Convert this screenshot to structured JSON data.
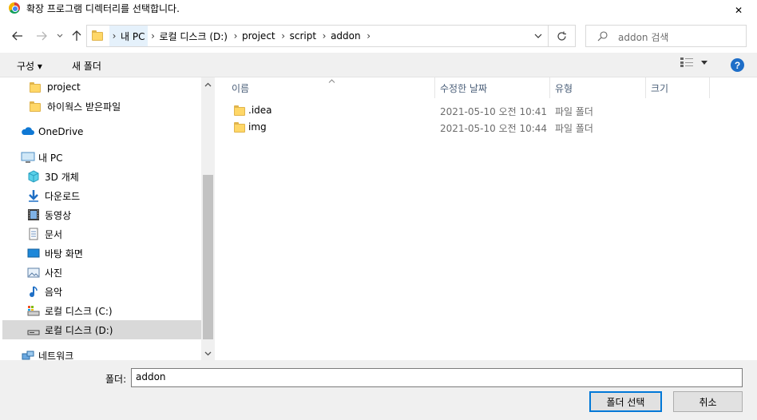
{
  "window": {
    "title": "확장 프로그램 디렉터리를 선택합니다.",
    "close_glyph": "✕"
  },
  "address": {
    "crumbs": [
      "내 PC",
      "로컬 디스크 (D:)",
      "project",
      "script",
      "addon"
    ]
  },
  "search": {
    "placeholder": "addon 검색"
  },
  "toolbar": {
    "organize": "구성 ▾",
    "new_folder": "새 폴더",
    "help": "?"
  },
  "nav": {
    "items": [
      {
        "label": "project",
        "icon": "folder-icon"
      },
      {
        "label": "하이웍스 받은파일",
        "icon": "folder-icon"
      },
      {
        "label": "OneDrive",
        "icon": "cloud-icon"
      },
      {
        "label": "내 PC",
        "icon": "computer-icon"
      },
      {
        "label": "3D 개체",
        "icon": "cube-icon"
      },
      {
        "label": "다운로드",
        "icon": "download-icon"
      },
      {
        "label": "동영상",
        "icon": "video-icon"
      },
      {
        "label": "문서",
        "icon": "document-icon"
      },
      {
        "label": "바탕 화면",
        "icon": "desktop-icon"
      },
      {
        "label": "사진",
        "icon": "pictures-icon"
      },
      {
        "label": "음악",
        "icon": "music-icon"
      },
      {
        "label": "로컬 디스크 (C:)",
        "icon": "drive-icon"
      },
      {
        "label": "로컬 디스크 (D:)",
        "icon": "drive-icon",
        "selected": true
      },
      {
        "label": "네트워크",
        "icon": "network-icon"
      }
    ]
  },
  "columns": {
    "name": "이름",
    "date": "수정한 날짜",
    "type": "유형",
    "size": "크기"
  },
  "files": [
    {
      "name": ".idea",
      "date": "2021-05-10 오전 10:41",
      "type": "파일 폴더"
    },
    {
      "name": "img",
      "date": "2021-05-10 오전 10:44",
      "type": "파일 폴더"
    }
  ],
  "footer": {
    "folder_label": "폴더:",
    "folder_value": "addon",
    "select_button": "폴더 선택",
    "cancel_button": "취소"
  },
  "colors": {
    "accent": "#0078d7",
    "selected_bg": "#d9d9d9",
    "folder": "#ffd767"
  }
}
